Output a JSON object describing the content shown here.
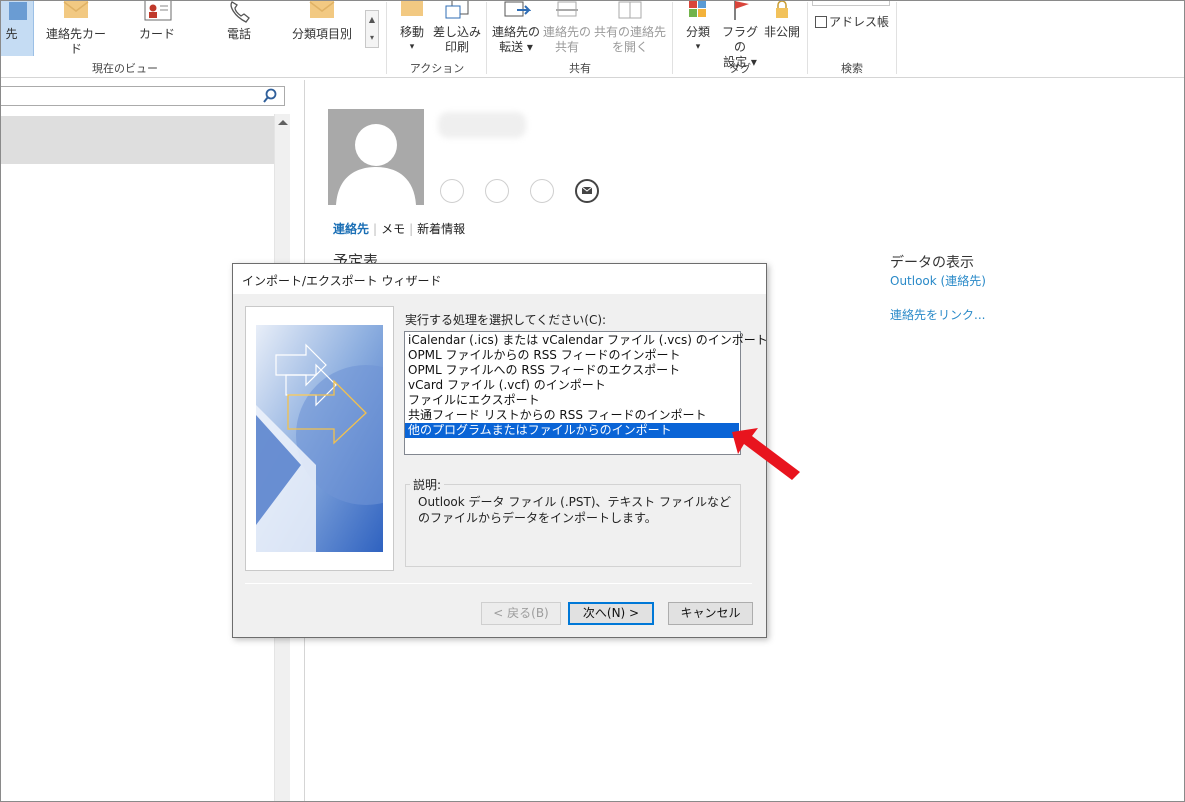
{
  "ribbon": {
    "views": [
      {
        "label": "先",
        "icon": "contact-card-icon"
      },
      {
        "label": "連絡先カード",
        "icon": "envelope-icon"
      },
      {
        "label": "カード",
        "icon": "business-card-icon"
      },
      {
        "label": "電話",
        "icon": "phone-icon"
      },
      {
        "label": "分類項目別",
        "icon": "envelope-icon"
      }
    ],
    "group_view_label": "現在のビュー",
    "actions": [
      {
        "line1": "移動",
        "line2": "▾",
        "icon": "folder-move-icon"
      },
      {
        "line1": "差し込み",
        "line2": "印刷",
        "icon": "mail-merge-icon"
      }
    ],
    "group_action_label": "アクション",
    "share": [
      {
        "line1": "連絡先の",
        "line2": "転送 ▾",
        "icon": "forward-contact-icon"
      },
      {
        "line1": "連絡先の",
        "line2": "共有",
        "icon": "share-contact-icon"
      },
      {
        "line1": "共有の連絡先",
        "line2": "を開く",
        "icon": "open-shared-icon"
      }
    ],
    "group_share_label": "共有",
    "tags": [
      {
        "line1": "分類",
        "line2": "▾",
        "icon": "categorize-icon"
      },
      {
        "line1": "フラグの",
        "line2": "設定 ▾",
        "icon": "flag-icon"
      },
      {
        "line1": "非公開",
        "line2": "",
        "icon": "lock-icon"
      }
    ],
    "group_tags_label": "タグ",
    "address_book_label": "アドレス帳",
    "group_search_label": "検索"
  },
  "contact": {
    "tabs": [
      "連絡先",
      "メモ",
      "新着情報"
    ],
    "heading_partial": "予定表",
    "data_view_heading": "データの表示",
    "data_source_link": "Outlook (連絡先)",
    "link_contact": "連絡先をリンク..."
  },
  "dialog": {
    "title": "インポート/エクスポート ウィザード",
    "prompt": "実行する処理を選択してください(C):",
    "options": [
      "iCalendar (.ics) または vCalendar ファイル (.vcs) のインポート",
      "OPML ファイルからの RSS フィードのインポート",
      "OPML ファイルへの RSS フィードのエクスポート",
      "vCard ファイル (.vcf) のインポート",
      "ファイルにエクスポート",
      "共通フィード リストからの RSS フィードのインポート",
      "他のプログラムまたはファイルからのインポート"
    ],
    "selected_index": 6,
    "description_label": "説明:",
    "description": "Outlook データ ファイル (.PST)、テキスト ファイルなどのファイルからデータをインポートします。",
    "back_button": "< 戻る(B)",
    "next_button": "次へ(N) >",
    "cancel_button": "キャンセル"
  },
  "colors": {
    "accent_link": "#2a8ac8",
    "tab_active": "#1b6fb5",
    "selection": "#0a64d6",
    "annotation_arrow": "#e8141e"
  }
}
